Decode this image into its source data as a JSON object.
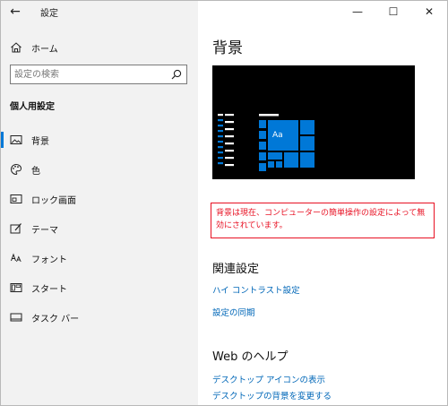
{
  "window": {
    "app_title": "設定",
    "minimize": "—",
    "maximize": "☐",
    "close": "✕"
  },
  "sidebar": {
    "home_label": "ホーム",
    "search_placeholder": "設定の検索",
    "section_title": "個人用設定",
    "items": [
      {
        "label": "背景",
        "icon": "image-icon",
        "active": true
      },
      {
        "label": "色",
        "icon": "palette-icon"
      },
      {
        "label": "ロック画面",
        "icon": "lock-screen-icon"
      },
      {
        "label": "テーマ",
        "icon": "theme-icon"
      },
      {
        "label": "フォント",
        "icon": "font-icon"
      },
      {
        "label": "スタート",
        "icon": "start-icon"
      },
      {
        "label": "タスク バー",
        "icon": "taskbar-icon"
      }
    ]
  },
  "main": {
    "title": "背景",
    "preview_tile_label": "Aa",
    "warning_text": "背景は現在、コンピューターの簡単操作の設定によって無効にされています。",
    "related_heading": "関連設定",
    "related_links": [
      "ハイ コントラスト設定",
      "設定の同期"
    ],
    "web_heading": "Web のヘルプ",
    "web_links": [
      "デスクトップ アイコンの表示",
      "デスクトップの背景を変更する"
    ]
  },
  "colors": {
    "accent": "#0078d7",
    "tile": "#0078d7",
    "warning": "#e81123",
    "link": "#0067b8",
    "sidebar_bg": "#f2f2f2"
  }
}
